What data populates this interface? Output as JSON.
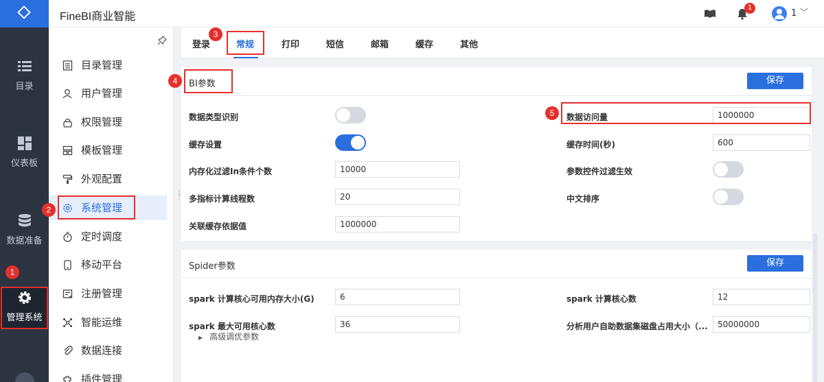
{
  "app": {
    "title": "FineBI商业智能"
  },
  "header": {
    "notification_count": "1",
    "user_name": "1"
  },
  "rail": {
    "items": [
      {
        "label": "目录",
        "icon": "list-icon"
      },
      {
        "label": "仪表板",
        "icon": "dashboard-icon"
      },
      {
        "label": "数据准备",
        "icon": "database-icon"
      },
      {
        "label": "管理系统",
        "icon": "gear-icon",
        "active": true
      }
    ]
  },
  "submenu": {
    "items": [
      {
        "label": "目录管理",
        "icon": "catalog-icon"
      },
      {
        "label": "用户管理",
        "icon": "user-icon"
      },
      {
        "label": "权限管理",
        "icon": "lock-icon"
      },
      {
        "label": "模板管理",
        "icon": "template-icon"
      },
      {
        "label": "外观配置",
        "icon": "paint-roller-icon"
      },
      {
        "label": "系统管理",
        "icon": "settings-icon",
        "active": true
      },
      {
        "label": "定时调度",
        "icon": "timer-icon"
      },
      {
        "label": "移动平台",
        "icon": "mobile-icon"
      },
      {
        "label": "注册管理",
        "icon": "register-icon"
      },
      {
        "label": "智能运维",
        "icon": "ops-icon"
      },
      {
        "label": "数据连接",
        "icon": "link-icon"
      },
      {
        "label": "插件管理",
        "icon": "plugin-icon"
      }
    ]
  },
  "tabs": [
    {
      "label": "登录"
    },
    {
      "label": "常规",
      "active": true
    },
    {
      "label": "打印"
    },
    {
      "label": "短信"
    },
    {
      "label": "邮箱"
    },
    {
      "label": "缓存"
    },
    {
      "label": "其他"
    }
  ],
  "bi_params": {
    "title": "BI参数",
    "save_label": "保存",
    "data_type_recognition": {
      "label": "数据类型识别",
      "on": false
    },
    "cache_setting": {
      "label": "缓存设置",
      "on": true
    },
    "in_condition_count": {
      "label": "内存化过滤In条件个数",
      "value": "10000"
    },
    "multi_metric_threads": {
      "label": "多指标计算线程数",
      "value": "20"
    },
    "relation_cache_basis": {
      "label": "关联缓存依据值",
      "value": "1000000"
    },
    "data_access_volume": {
      "label": "数据访问量",
      "value": "1000000"
    },
    "cache_time": {
      "label": "缓存时间(秒)",
      "value": "600"
    },
    "param_filter_effective": {
      "label": "参数控件过滤生效",
      "on": false
    },
    "chinese_sort": {
      "label": "中文排序",
      "on": false
    }
  },
  "spider_params": {
    "title": "Spider参数",
    "save_label": "保存",
    "spark_core_memory": {
      "label": "spark 计算核心可用内存大小(G)",
      "value": "6"
    },
    "spark_max_cores": {
      "label": "spark 最大可用核心数",
      "value": "36"
    },
    "spark_core_count": {
      "label": "spark 计算核心数",
      "value": "12"
    },
    "user_dataset_disk": {
      "label": "分析用户自助数据集磁盘占用大小（...",
      "value": "50000000"
    },
    "advanced_label": "高级调优参数"
  },
  "annotations": [
    "1",
    "2",
    "3",
    "4",
    "5"
  ],
  "colors": {
    "primary": "#2b6fde",
    "rail_bg": "#2c3442",
    "annotation_red": "#e5302b"
  }
}
